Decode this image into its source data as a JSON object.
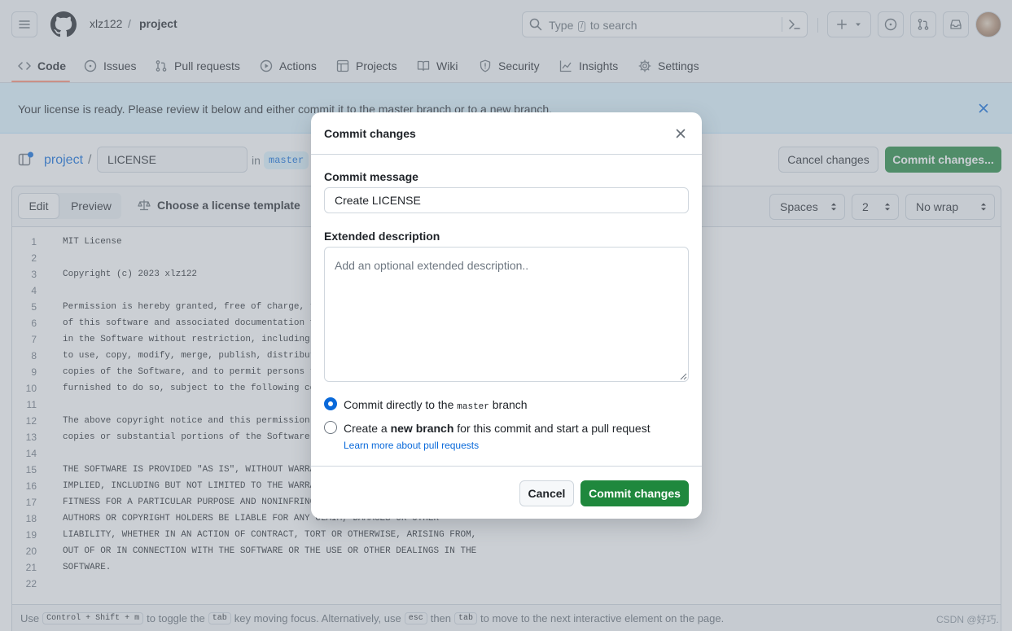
{
  "header": {
    "owner": "xlz122",
    "separator": "/",
    "repo": "project",
    "search_prefix": "Type",
    "search_key": "/",
    "search_suffix": "to search"
  },
  "nav": {
    "tabs": [
      {
        "label": "Code",
        "icon": "code-icon"
      },
      {
        "label": "Issues",
        "icon": "issue-icon"
      },
      {
        "label": "Pull requests",
        "icon": "pull-request-icon"
      },
      {
        "label": "Actions",
        "icon": "play-icon"
      },
      {
        "label": "Projects",
        "icon": "table-icon"
      },
      {
        "label": "Wiki",
        "icon": "book-icon"
      },
      {
        "label": "Security",
        "icon": "shield-icon"
      },
      {
        "label": "Insights",
        "icon": "graph-icon"
      },
      {
        "label": "Settings",
        "icon": "gear-icon"
      }
    ]
  },
  "flash": {
    "message": "Your license is ready. Please review it below and either commit it to the master branch or to a new branch."
  },
  "editor": {
    "path_repo": "project",
    "path_sep": "/",
    "filename": "LICENSE",
    "in_label": "in",
    "branch": "master",
    "cancel_label": "Cancel changes",
    "commit_label": "Commit changes...",
    "edit_tab": "Edit",
    "preview_tab": "Preview",
    "template_label": "Choose a license template",
    "indent_mode": "Spaces",
    "indent_size": "2",
    "wrap_mode": "No wrap",
    "lines": [
      "MIT License",
      "",
      "Copyright (c) 2023 xlz122",
      "",
      "Permission is hereby granted, free of charge, t",
      "of this software and associated documentation f",
      "in the Software without restriction, including",
      "to use, copy, modify, merge, publish, distribut",
      "copies of the Software, and to permit persons t",
      "furnished to do so, subject to the following co",
      "",
      "The above copyright notice and this permission",
      "copies or substantial portions of the Software",
      "",
      "THE SOFTWARE IS PROVIDED \"AS IS\", WITHOUT WARRA",
      "IMPLIED, INCLUDING BUT NOT LIMITED TO THE WARRA",
      "FITNESS FOR A PARTICULAR PURPOSE AND NONINFRING",
      "AUTHORS OR COPYRIGHT HOLDERS BE LIABLE FOR ANY CLAIM, DAMAGES OR OTHER",
      "LIABILITY, WHETHER IN AN ACTION OF CONTRACT, TORT OR OTHERWISE, ARISING FROM,",
      "OUT OF OR IN CONNECTION WITH THE SOFTWARE OR THE USE OR OTHER DEALINGS IN THE",
      "SOFTWARE.",
      ""
    ],
    "footer": {
      "t1": "Use",
      "k1": "Control + Shift + m",
      "t2": "to toggle the",
      "k2": "tab",
      "t3": "key moving focus. Alternatively, use",
      "k3": "esc",
      "t4": "then",
      "k4": "tab",
      "t5": "to move to the next interactive element on the page."
    }
  },
  "watermark": "CSDN @好巧.",
  "dialog": {
    "title": "Commit changes",
    "message_label": "Commit message",
    "message_value": "Create LICENSE",
    "description_label": "Extended description",
    "description_placeholder": "Add an optional extended description..",
    "option1_prefix": "Commit directly to the",
    "option1_branch": "master",
    "option1_suffix": "branch",
    "option2_prefix": "Create a",
    "option2_bold": "new branch",
    "option2_suffix": "for this commit and start a pull request",
    "learn_more": "Learn more about pull requests",
    "cancel": "Cancel",
    "commit": "Commit changes"
  },
  "colors": {
    "primary_green": "#1f883d",
    "link_blue": "#0969da",
    "active_tab_underline": "#fd8c73",
    "flash_bg": "#ddf4ff"
  }
}
